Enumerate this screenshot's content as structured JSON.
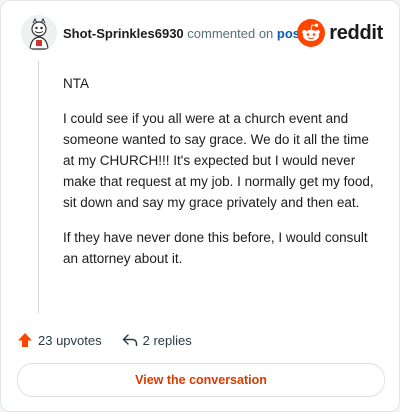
{
  "comment": {
    "username": "Shot-Sprinkles6930",
    "action_text": "commented on",
    "post_link": "post",
    "paragraphs": [
      "NTA",
      "I could see if you all were at a church event and someone wanted to say grace. We do it all the time at my CHURCH!!! It's expected but I would never make that request at my job. I normally get my food, sit down and say my grace privately and then eat.",
      "If they have never done this before, I would consult an attorney about it."
    ]
  },
  "brand": {
    "name": "reddit",
    "color": "#ff4500"
  },
  "actions": {
    "upvotes_label": "23 upvotes",
    "replies_label": "2 replies"
  },
  "cta": {
    "label": "View the conversation"
  },
  "icons": [
    "avatar",
    "reddit-logo-icon",
    "upvote-arrow-icon",
    "reply-icon"
  ]
}
